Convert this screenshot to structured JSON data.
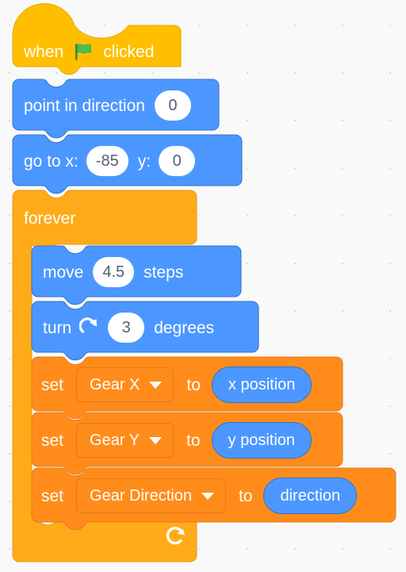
{
  "editor": {
    "name": "scratch-block-workspace",
    "background_color": "#f9f9f9",
    "grid_dot_color": "#d9d9d9"
  },
  "palette": {
    "events_color": "#ffbf00",
    "motion_color": "#4c97ff",
    "motion_stroke": "#3373cc",
    "control_color": "#ffab19",
    "control_stroke": "#e6991a",
    "variables_color": "#ff8c1a",
    "variables_stroke": "#e6771a",
    "input_text_color": "#575e75"
  },
  "script": {
    "hat": {
      "label_before": "when",
      "icon": "green-flag-icon",
      "label_after": "clicked"
    },
    "point_in_direction": {
      "label": "point in direction",
      "value": "0"
    },
    "go_to_xy": {
      "label_x": "go to x:",
      "value_x": "-85",
      "label_y": "y:",
      "value_y": "0"
    },
    "forever": {
      "label": "forever",
      "loop_icon": "loop-arrow-icon"
    },
    "move_steps": {
      "label_before": "move",
      "value": "4.5",
      "label_after": "steps"
    },
    "turn_degrees": {
      "label_before": "turn",
      "icon": "turn-clockwise-icon",
      "value": "3",
      "label_after": "degrees"
    },
    "set_blocks": [
      {
        "label_set": "set",
        "variable": "Gear X",
        "dropdown_icon": "chevron-down-icon",
        "label_to": "to",
        "reporter": "x position"
      },
      {
        "label_set": "set",
        "variable": "Gear Y",
        "dropdown_icon": "chevron-down-icon",
        "label_to": "to",
        "reporter": "y position"
      },
      {
        "label_set": "set",
        "variable": "Gear Direction",
        "dropdown_icon": "chevron-down-icon",
        "label_to": "to",
        "reporter": "direction"
      }
    ]
  }
}
